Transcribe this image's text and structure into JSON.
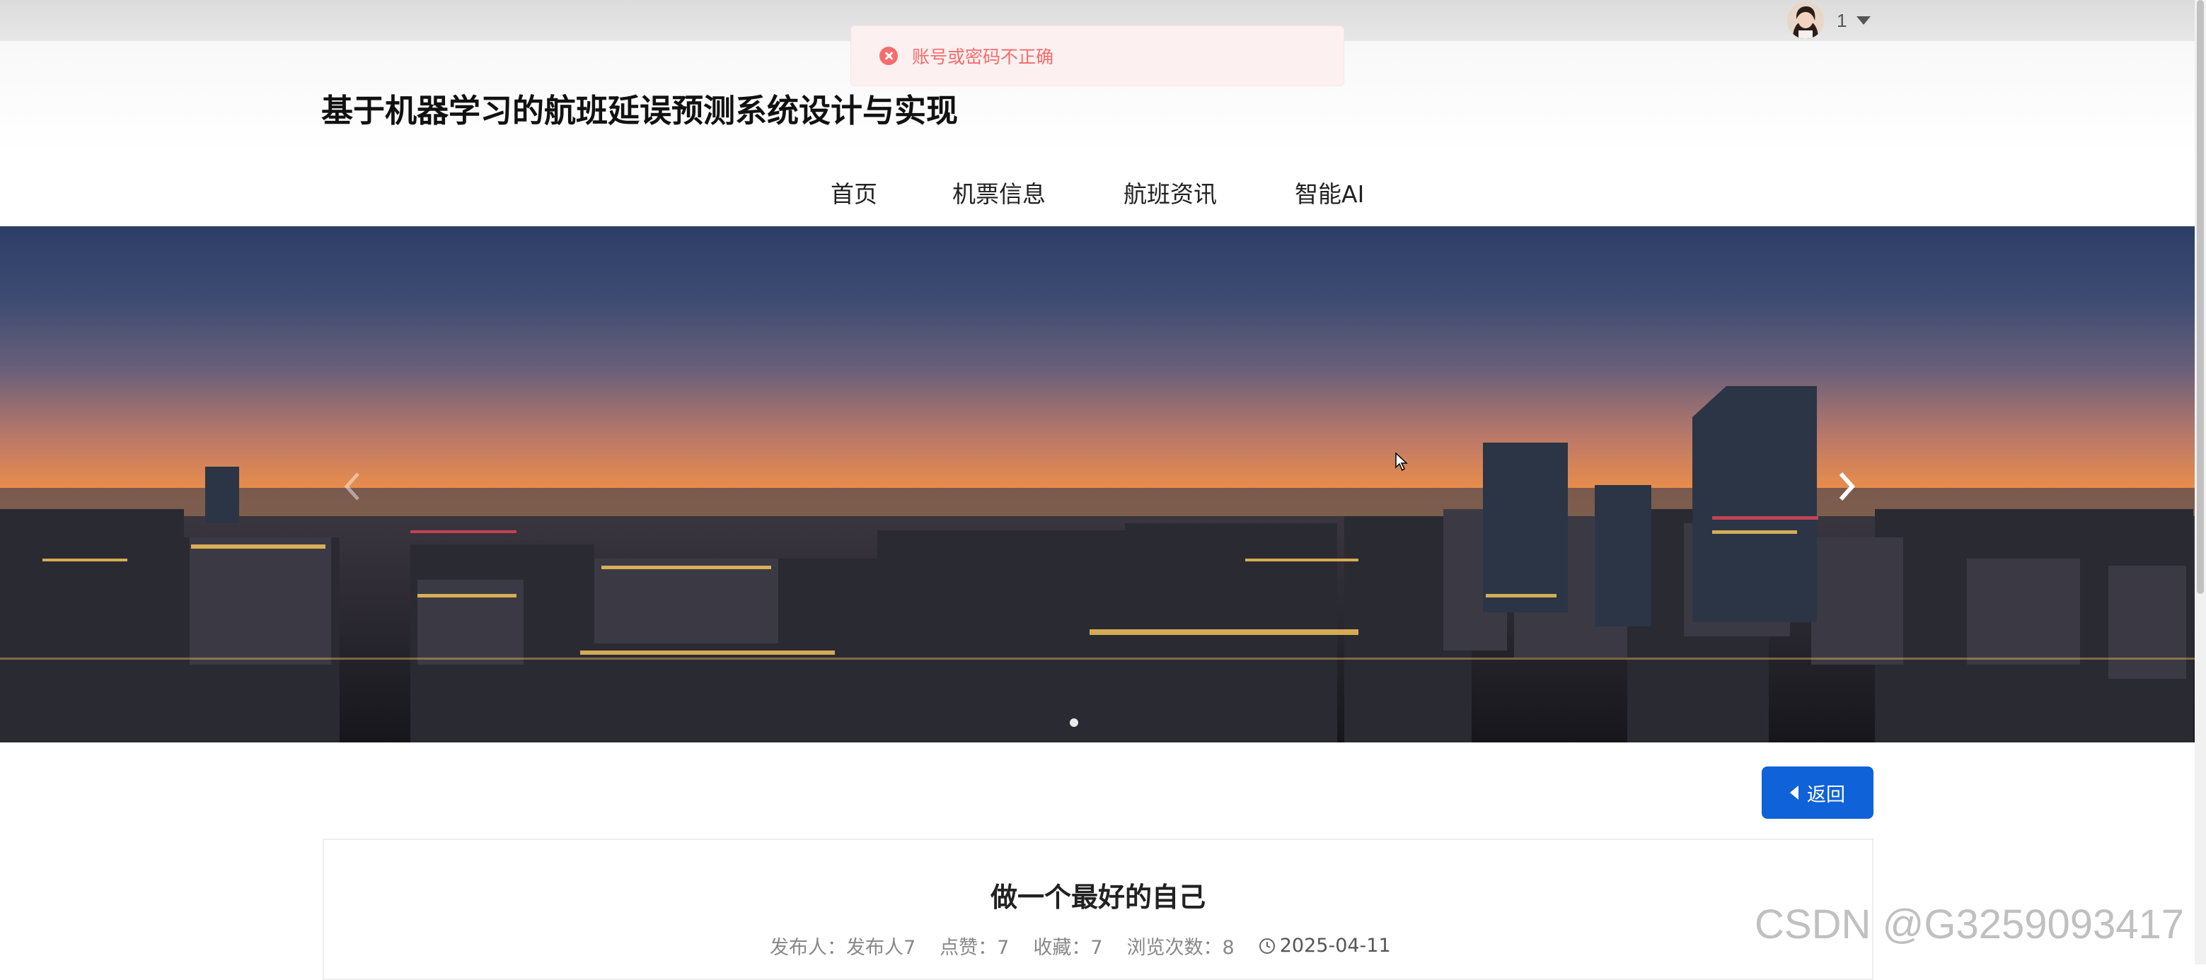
{
  "user": {
    "name": "1"
  },
  "toast": {
    "message": "账号或密码不正确",
    "type": "error"
  },
  "header": {
    "site_title": "基于机器学习的航班延误预测系统设计与实现",
    "nav": [
      {
        "label": "首页"
      },
      {
        "label": "机票信息"
      },
      {
        "label": "航班资讯"
      },
      {
        "label": "智能AI"
      }
    ]
  },
  "banner": {
    "slide_count": 1,
    "active_slide": 1
  },
  "back_button": {
    "label": "返回"
  },
  "article": {
    "title": "做一个最好的自己",
    "publisher": "发布人：发布人7",
    "likes": "点赞：7",
    "favorites": "收藏：7",
    "views": "浏览次数：8",
    "date": "2025-04-11"
  },
  "watermark": "CSDN @G3259093417",
  "colors": {
    "primary": "#0f62d8",
    "error": "#f56c6c",
    "error_bg": "#fdf0f0"
  },
  "icons": [
    "avatar",
    "caret-down-icon",
    "error-circle-icon",
    "chevron-left-icon",
    "chevron-right-icon",
    "caret-left-icon",
    "clock-icon"
  ]
}
